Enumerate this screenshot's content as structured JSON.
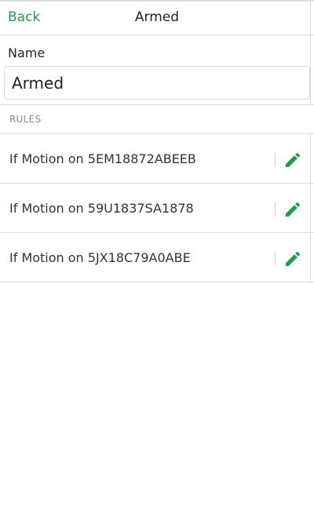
{
  "nav": {
    "back_label": "Back",
    "title": "Armed"
  },
  "form": {
    "name_label": "Name",
    "name_value": "Armed"
  },
  "rules": {
    "header": "RULES",
    "items": [
      {
        "label": "If Motion on 5EM18872ABEEB",
        "icon": "pencil-icon"
      },
      {
        "label": "If Motion on 59U1837SA1878",
        "icon": "pencil-icon"
      },
      {
        "label": "If Motion on 5JX18C79A0ABE",
        "icon": "pencil-icon"
      }
    ]
  },
  "colors": {
    "accent": "#1e9b4b",
    "divider": "#dcdcdc",
    "muted_text": "#8e8e8e"
  }
}
